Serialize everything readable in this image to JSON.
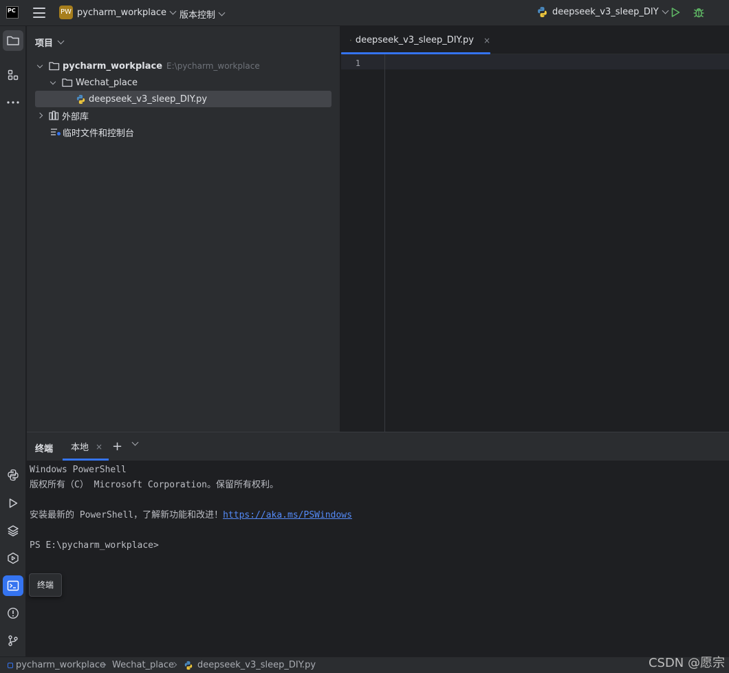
{
  "titlebar": {
    "logo_text": "PC",
    "project_badge": "PW",
    "project_name": "pycharm_workplace",
    "vcs_label": "版本控制",
    "run_config": "deepseek_v3_sleep_DIY"
  },
  "project_panel": {
    "header": "项目",
    "tree": {
      "root_name": "pycharm_workplace",
      "root_path": "E:\\pycharm_workplace",
      "folder": "Wechat_place",
      "file": "deepseek_v3_sleep_DIY.py",
      "external_libs": "外部库",
      "scratches": "临时文件和控制台"
    }
  },
  "editor": {
    "tab_label": "deepseek_v3_sleep_DIY.py",
    "tab_close": "×",
    "line_numbers": [
      "1"
    ]
  },
  "terminal": {
    "title": "终端",
    "tab_label": "本地",
    "tab_close": "×",
    "add_label": "+",
    "lines": {
      "l1": "Windows PowerShell",
      "l2": "版权所有（C） Microsoft Corporation。保留所有权利。",
      "l3_prefix": "安装最新的 PowerShell，了解新功能和改进！",
      "l3_link": "https://aka.ms/PSWindows",
      "l4": "PS E:\\pycharm_workplace>"
    }
  },
  "tooltip": "终端",
  "statusbar": {
    "crumb1": "pycharm_workplace",
    "crumb2": "Wechat_place",
    "crumb3": "deepseek_v3_sleep_DIY.py"
  },
  "watermark": "CSDN @愿宗",
  "colors": {
    "accent": "#3574f0",
    "run_green": "#5fb865",
    "link": "#548af7",
    "badge": "#a77e1c"
  }
}
